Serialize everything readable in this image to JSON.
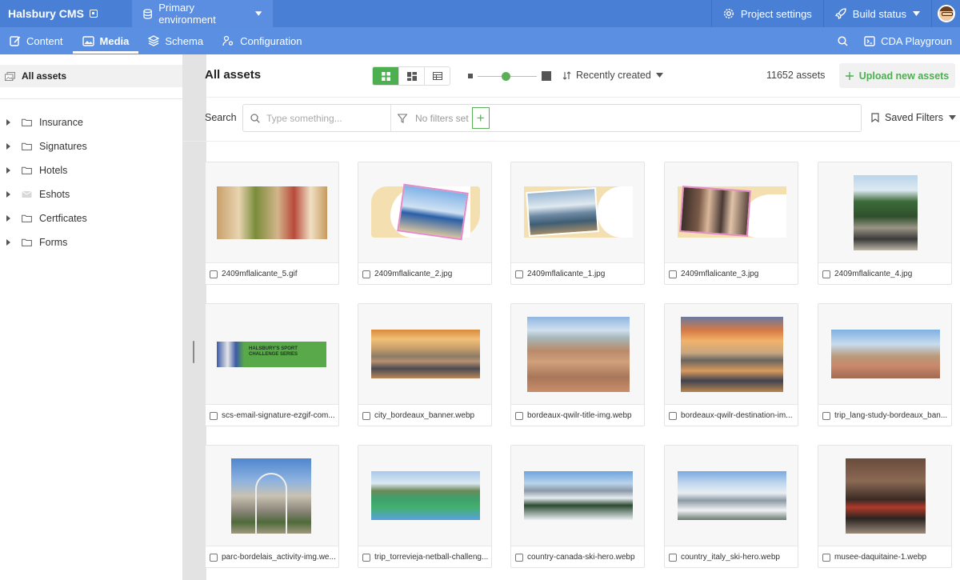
{
  "topbar": {
    "brand": "Halsbury CMS",
    "environment": "Primary environment",
    "project_settings": "Project settings",
    "build_status": "Build status"
  },
  "nav": {
    "content": "Content",
    "media": "Media",
    "schema": "Schema",
    "configuration": "Configuration",
    "cda_playground": "CDA Playgroun"
  },
  "sidebar": {
    "all_assets": "All assets",
    "folders": [
      {
        "label": "Insurance",
        "icon": "folder-icon"
      },
      {
        "label": "Signatures",
        "icon": "folder-icon"
      },
      {
        "label": "Hotels",
        "icon": "folder-icon"
      },
      {
        "label": "Eshots",
        "icon": "mail-folder-icon"
      },
      {
        "label": "Certficates",
        "icon": "folder-icon"
      },
      {
        "label": "Forms",
        "icon": "folder-icon"
      }
    ]
  },
  "main": {
    "title": "All assets",
    "sort_label": "Recently created",
    "asset_count": "11652 assets",
    "upload_label": "Upload new assets",
    "search_label": "Search",
    "search_placeholder": "Type something...",
    "filters_label": "No filters set",
    "saved_filters": "Saved Filters"
  },
  "assets": [
    "2409mflalicante_5.gif",
    "2409mflalicante_2.jpg",
    "2409mflalicante_1.jpg",
    "2409mflalicante_3.jpg",
    "2409mflalicante_4.jpg",
    "scs-email-signature-ezgif-com...",
    "city_bordeaux_banner.webp",
    "bordeaux-qwilr-title-img.webp",
    "bordeaux-qwilr-destination-im...",
    "trip_lang-study-bordeaux_ban...",
    "parc-bordelais_activity-img.we...",
    "trip_torrevieja-netball-challeng...",
    "country-canada-ski-hero.webp",
    "country_italy_ski-hero.webp",
    "musee-daquitaine-1.webp"
  ],
  "banner_text": "HALSBURY'S SPORT CHALLENGE SERIES",
  "colors": {
    "topbar": "#4a7fd6",
    "navbar": "#5a8fe2",
    "accent_green": "#4caf50"
  }
}
